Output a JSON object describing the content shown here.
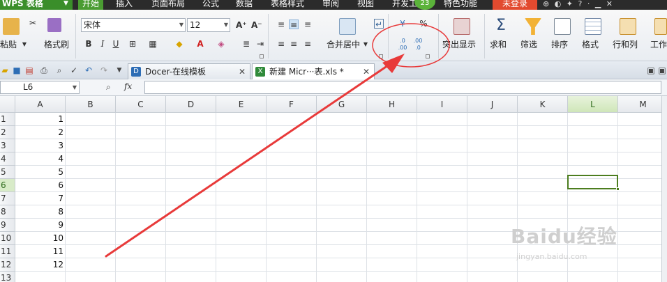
{
  "titlebar": {
    "app_name": "WPS 表格",
    "tabs": [
      "开始",
      "插入",
      "页面布局",
      "公式",
      "数据",
      "表格样式",
      "审阅",
      "视图",
      "开发工具",
      "特色功能"
    ],
    "active_tab": "开始",
    "badge": "23",
    "login": "未登录",
    "icons": "⊕ ◐ ✦ ? · ▁ ✕"
  },
  "ribbon": {
    "paste_label": "粘贴",
    "format_painter_label": "格式刷",
    "font_name": "宋体",
    "font_size": "12",
    "bold": "B",
    "italic": "I",
    "underline": "U",
    "merge_label": "合并居中",
    "percent": "%",
    "inc_decimal": ".0 .00",
    "dec_decimal": ".00 .0",
    "conditional_label": "突出显示",
    "sum_label": "求和",
    "filter_label": "筛选",
    "sort_label": "排序",
    "format_label": "格式",
    "rowcol_label": "行和列",
    "worksheet_label": "工作"
  },
  "doctabs": [
    {
      "label": "Docer-在线模板",
      "close": "✕"
    },
    {
      "label": "新建 Micr···表.xls *",
      "close": "✕"
    }
  ],
  "formula": {
    "cell_ref": "L6",
    "fx": "fx",
    "value": ""
  },
  "sheet": {
    "columns": [
      "A",
      "B",
      "C",
      "D",
      "E",
      "F",
      "G",
      "H",
      "I",
      "J",
      "K",
      "L",
      "M"
    ],
    "selected_column": "L",
    "rows": [
      "1",
      "2",
      "3",
      "4",
      "5",
      "6",
      "7",
      "8",
      "9",
      "10",
      "11",
      "12",
      "13"
    ],
    "selected_row": "6",
    "col_a_values": [
      "1",
      "2",
      "3",
      "4",
      "5",
      "6",
      "7",
      "8",
      "9",
      "10",
      "11",
      "12"
    ],
    "selected_cell": "L6"
  },
  "watermark": {
    "text": "Baidu经验",
    "url": "jingyan.baidu.com"
  },
  "colors": {
    "accent_green": "#3a8e2a",
    "selection_green": "#4c7d1f",
    "annotation_red": "#e83a3a",
    "login_red": "#e24a2f"
  }
}
